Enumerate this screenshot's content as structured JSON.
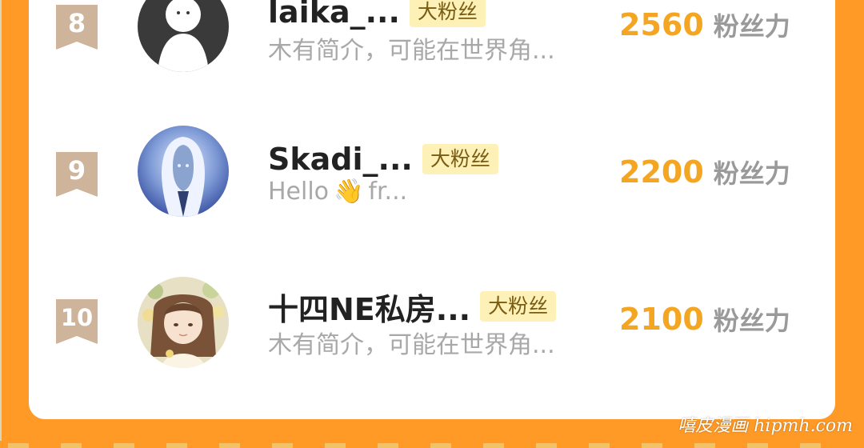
{
  "colors": {
    "page_background": "#ff9a26",
    "card_background": "#ffffff",
    "score_color": "#f4a521",
    "tag_background": "#fdf1b8",
    "badge_color": "#cdb49a"
  },
  "ranking": [
    {
      "rank": "8",
      "name": "laika_...",
      "tag": "大粉丝",
      "bio": "木有简介，可能在世界角...",
      "score": "2560",
      "score_unit": "粉丝力",
      "avatar_icon": "default-user-avatar"
    },
    {
      "rank": "9",
      "name": "Skadi_...",
      "tag": "大粉丝",
      "bio_prefix": "Hello",
      "bio_emoji": "👋",
      "bio_suffix": "fr...",
      "score": "2200",
      "score_unit": "粉丝力",
      "avatar_icon": "hooded-figure-avatar"
    },
    {
      "rank": "10",
      "name": "十四NE私房...",
      "tag": "大粉丝",
      "bio": "木有简介，可能在世界角...",
      "score": "2100",
      "score_unit": "粉丝力",
      "avatar_icon": "anime-girl-avatar"
    }
  ],
  "watermark": "嘻皮漫画 hipmh.com"
}
